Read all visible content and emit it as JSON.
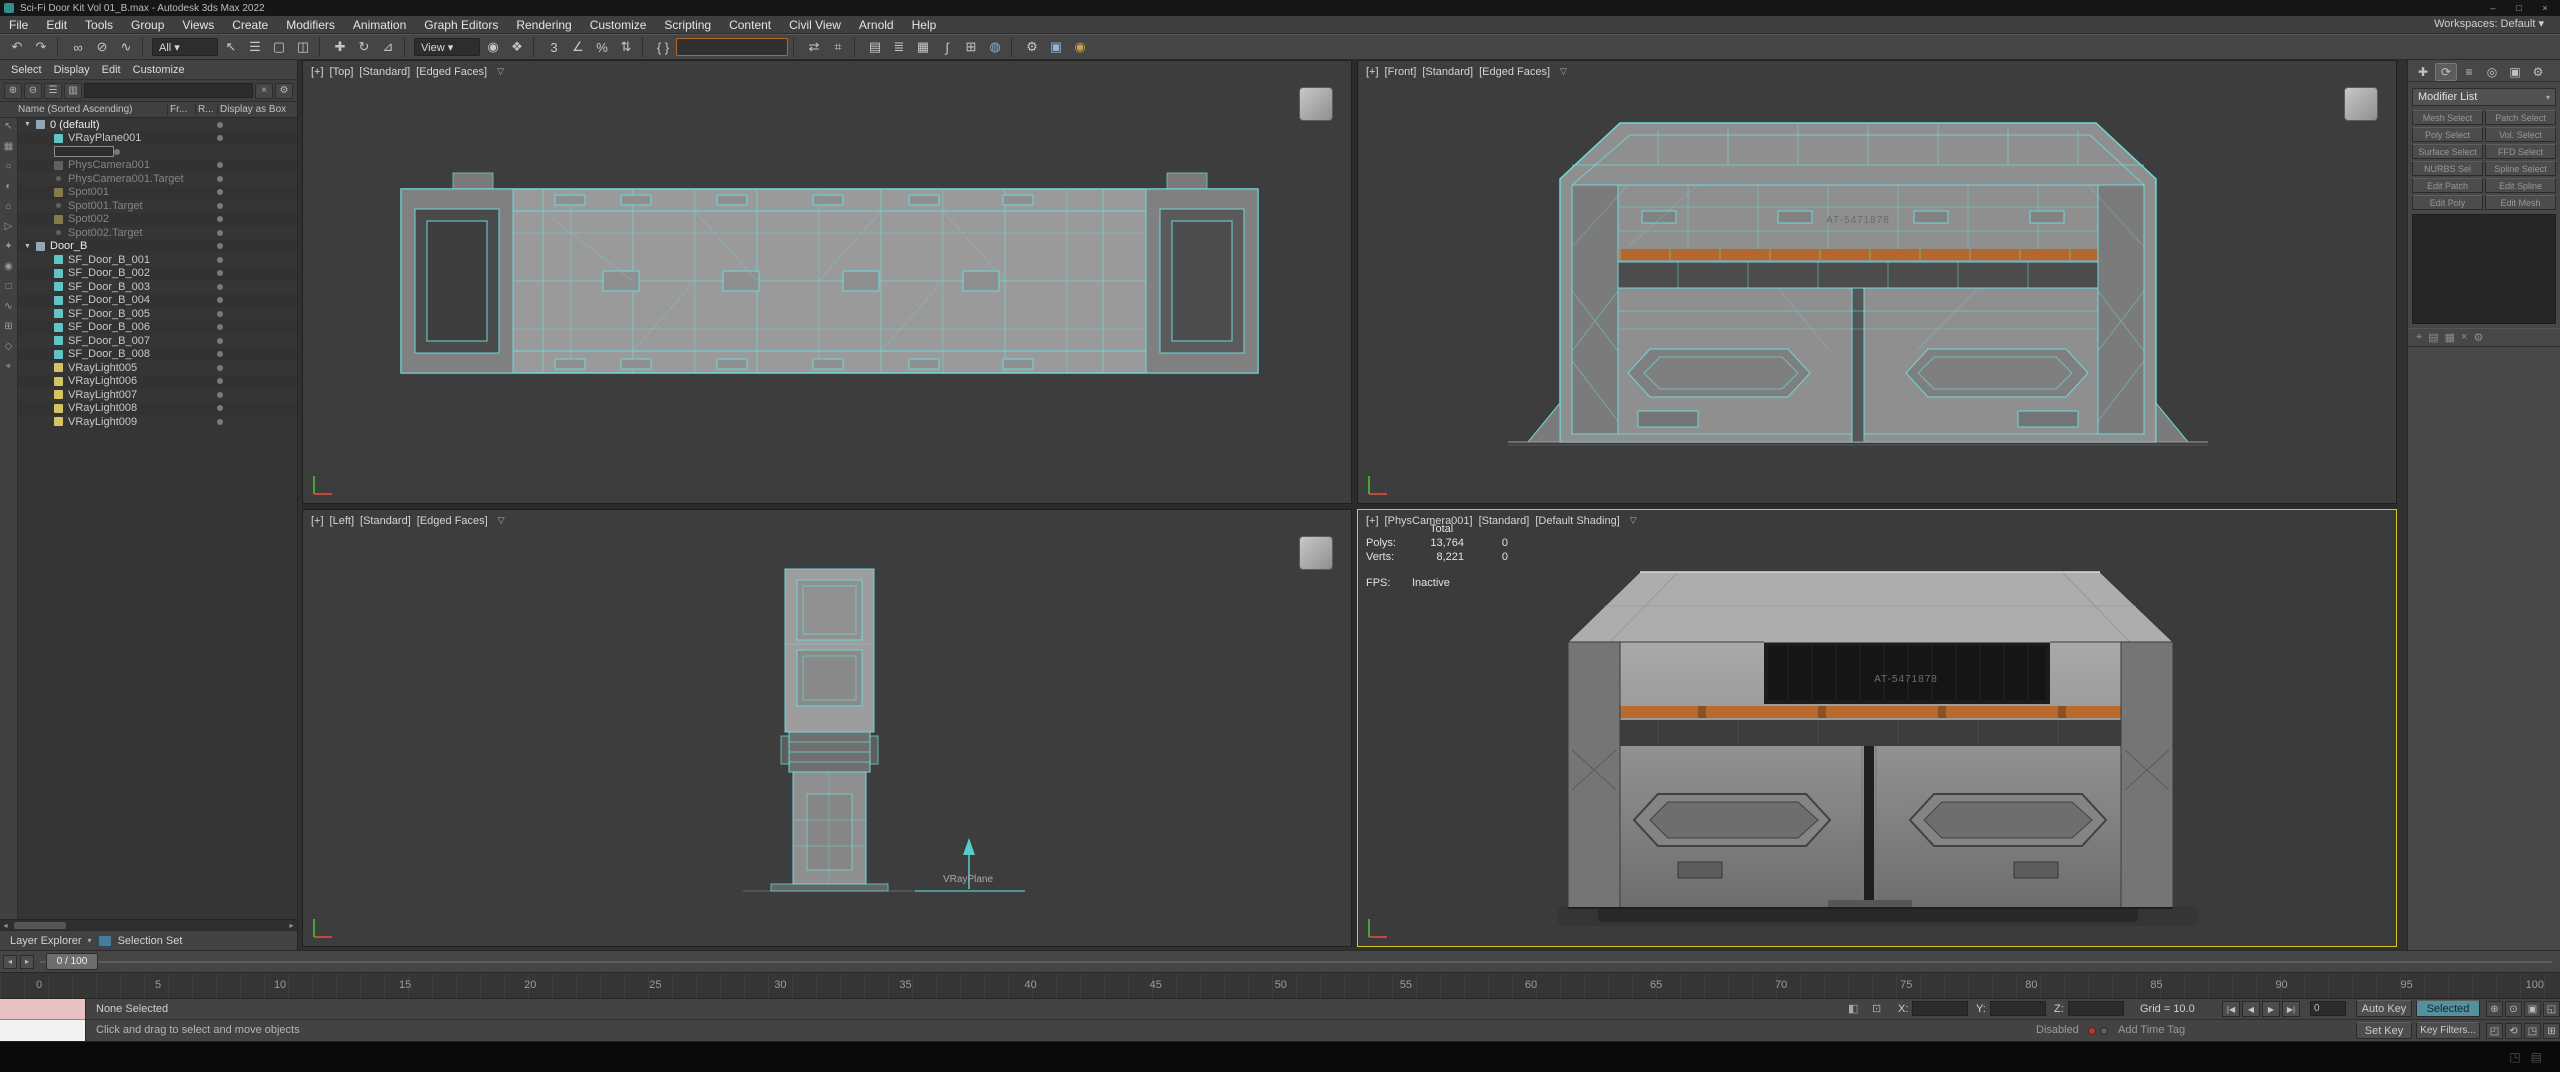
{
  "window": {
    "title": "Sci-Fi Door Kit Vol 01_B.max - Autodesk 3ds Max 2022",
    "controls": [
      "–",
      "□",
      "×"
    ]
  },
  "menu": {
    "items": [
      "File",
      "Edit",
      "Tools",
      "Group",
      "Views",
      "Create",
      "Modifiers",
      "Animation",
      "Graph Editors",
      "Rendering",
      "Customize",
      "Scripting",
      "Content",
      "Civil View",
      "Arnold",
      "Help"
    ],
    "workspaces": "Workspaces: Default ▾"
  },
  "toolbar": {
    "items": [
      {
        "g": "↶"
      },
      {
        "g": "↷"
      },
      {
        "cls": "sep"
      },
      {
        "g": "∞"
      },
      {
        "g": "⊘"
      },
      {
        "g": "∿"
      },
      {
        "cls": "sep"
      },
      {
        "g": "All ▾",
        "cls": "combo"
      },
      {
        "g": "↖"
      },
      {
        "g": "☰"
      },
      {
        "g": "▢"
      },
      {
        "g": "◫"
      },
      {
        "cls": "sep"
      },
      {
        "g": "✚"
      },
      {
        "g": "↻"
      },
      {
        "g": "⊿"
      },
      {
        "cls": "sep"
      },
      {
        "g": "View ▾",
        "cls": "combo"
      },
      {
        "g": "◉"
      },
      {
        "g": "❖"
      },
      {
        "cls": "sep"
      },
      {
        "g": "3"
      },
      {
        "g": "∠"
      },
      {
        "g": "%"
      },
      {
        "g": "⇅"
      },
      {
        "cls": "sep"
      },
      {
        "g": "{ }"
      },
      {
        "g": "",
        "cls": "sets"
      },
      {
        "cls": "sep"
      },
      {
        "g": "⇄"
      },
      {
        "g": "⌗"
      },
      {
        "cls": "sep"
      },
      {
        "g": "▤"
      },
      {
        "g": "≣"
      },
      {
        "g": "▦"
      },
      {
        "g": "∫"
      },
      {
        "g": "⊞"
      },
      {
        "g": "◍",
        "cls": "mat"
      },
      {
        "cls": "sep"
      },
      {
        "g": "⚙"
      },
      {
        "g": "▣",
        "cls": "blue"
      },
      {
        "g": "◉",
        "cls": "orange"
      }
    ]
  },
  "explorer": {
    "menus": [
      "Select",
      "Display",
      "Edit",
      "Customize"
    ],
    "top_icons": [
      "⊕",
      "⊖",
      "☰",
      "▥"
    ],
    "top_icons2": [
      "×",
      "⚙"
    ],
    "search_value": "",
    "columns": {
      "name": "Name (Sorted Ascending)",
      "c1": "Fr...",
      "c2": "R...",
      "c3": "Display as Box"
    },
    "left_icons": [
      "↖",
      "▦",
      "○",
      "◐",
      "⌂",
      "▷",
      "✦",
      "◉",
      "□",
      "∿",
      "⊞",
      "◇",
      "⌖"
    ],
    "rows": [
      {
        "name": "0 (default)",
        "arrow": "▼",
        "cls": "layer"
      },
      {
        "name": "VRayPlane001",
        "cls": "child geo"
      },
      {
        "name": "",
        "cls": "child editbox"
      },
      {
        "name": "PhysCamera001",
        "cls": "child cam dim"
      },
      {
        "name": "PhysCamera001.Target",
        "cls": "child tgt dim"
      },
      {
        "name": "Spot001",
        "cls": "child light dim"
      },
      {
        "name": "Spot001.Target",
        "cls": "child tgt dim"
      },
      {
        "name": "Spot002",
        "cls": "child light dim"
      },
      {
        "name": "Spot002.Target",
        "cls": "child tgt dim"
      },
      {
        "name": "Door_B",
        "arrow": "▼",
        "cls": "layer"
      },
      {
        "name": "SF_Door_B_001",
        "cls": "child geo"
      },
      {
        "name": "SF_Door_B_002",
        "cls": "child geo"
      },
      {
        "name": "SF_Door_B_003",
        "cls": "child geo"
      },
      {
        "name": "SF_Door_B_004",
        "cls": "child geo"
      },
      {
        "name": "SF_Door_B_005",
        "cls": "child geo"
      },
      {
        "name": "SF_Door_B_006",
        "cls": "child geo"
      },
      {
        "name": "SF_Door_B_007",
        "cls": "child geo"
      },
      {
        "name": "SF_Door_B_008",
        "cls": "child geo"
      },
      {
        "name": "VRayLight005",
        "cls": "child light2"
      },
      {
        "name": "VRayLight006",
        "cls": "child light2"
      },
      {
        "name": "VRayLight007",
        "cls": "child light2"
      },
      {
        "name": "VRayLight008",
        "cls": "child light2"
      },
      {
        "name": "VRayLight009",
        "cls": "child light2"
      }
    ],
    "bottom": {
      "layer_explorer": "Layer Explorer",
      "selection_set": "Selection Set"
    }
  },
  "viewports": {
    "tl": {
      "segments": [
        "[+]",
        "[Top]",
        "[Standard]",
        "[Edged Faces]"
      ]
    },
    "tr": {
      "segments": [
        "[+]",
        "[Front]",
        "[Standard]",
        "[Edged Faces]"
      ],
      "decal": "AT-5471878"
    },
    "bl": {
      "segments": [
        "[+]",
        "[Left]",
        "[Standard]",
        "[Edged Faces]"
      ],
      "vray_label": "VRayPlane"
    },
    "br": {
      "segments": [
        "[+]",
        "[PhysCamera001]",
        "[Standard]",
        "[Default Shading]"
      ],
      "decal": "AT-5471878",
      "stats": {
        "total": "Total",
        "polys_label": "Polys:",
        "polys": "13,764",
        "polys2": "0",
        "verts_label": "Verts:",
        "verts": "8,221",
        "verts2": "0",
        "fps_label": "FPS:",
        "fps": "Inactive"
      }
    }
  },
  "icons": {
    "funnel": "▽",
    "dropdown": "▾"
  },
  "command_panel": {
    "tabs": [
      "✚",
      "⟳",
      "≡",
      "◎",
      "▣",
      "⚙"
    ],
    "modifier_list": "Modifier List",
    "buttons": [
      "Mesh Select",
      "Patch Select",
      "Poly Select",
      "Vol. Select",
      "Surface Select",
      "FFD Select",
      "NURBS Sel",
      "Spline Select",
      "Edit Patch",
      "Edit Spline",
      "Edit Poly",
      "Edit Mesh"
    ],
    "stack_icons": [
      "⌖",
      "▤",
      "▦",
      "×",
      "⚙"
    ]
  },
  "timeline": {
    "bubble": "0 / 100",
    "ticks": [
      "0",
      "5",
      "10",
      "15",
      "20",
      "25",
      "30",
      "35",
      "40",
      "45",
      "50",
      "55",
      "60",
      "65",
      "70",
      "75",
      "80",
      "85",
      "90",
      "95",
      "100"
    ]
  },
  "status": {
    "line1": "None Selected",
    "line2": "Click and drag to select and move objects",
    "x_label": "X:",
    "y_label": "Y:",
    "z_label": "Z:",
    "x_value": "",
    "y_value": "",
    "z_value": "",
    "grid": "Grid = 10.0",
    "playback": [
      "|◀",
      "◀",
      "▶",
      "▶|"
    ],
    "frame": "0",
    "auto_key": "Auto Key",
    "set_key": "Set Key",
    "selected": "Selected",
    "key_filters": "Key Filters...",
    "disabled": "Disabled",
    "add_time_tag": "Add Time Tag",
    "nav1": [
      "⊕",
      "⊙",
      "▣",
      "◱"
    ],
    "nav2": [
      "◰",
      "⟲",
      "◳",
      "⊞"
    ],
    "black_icons": [
      "◳",
      "▤"
    ]
  }
}
